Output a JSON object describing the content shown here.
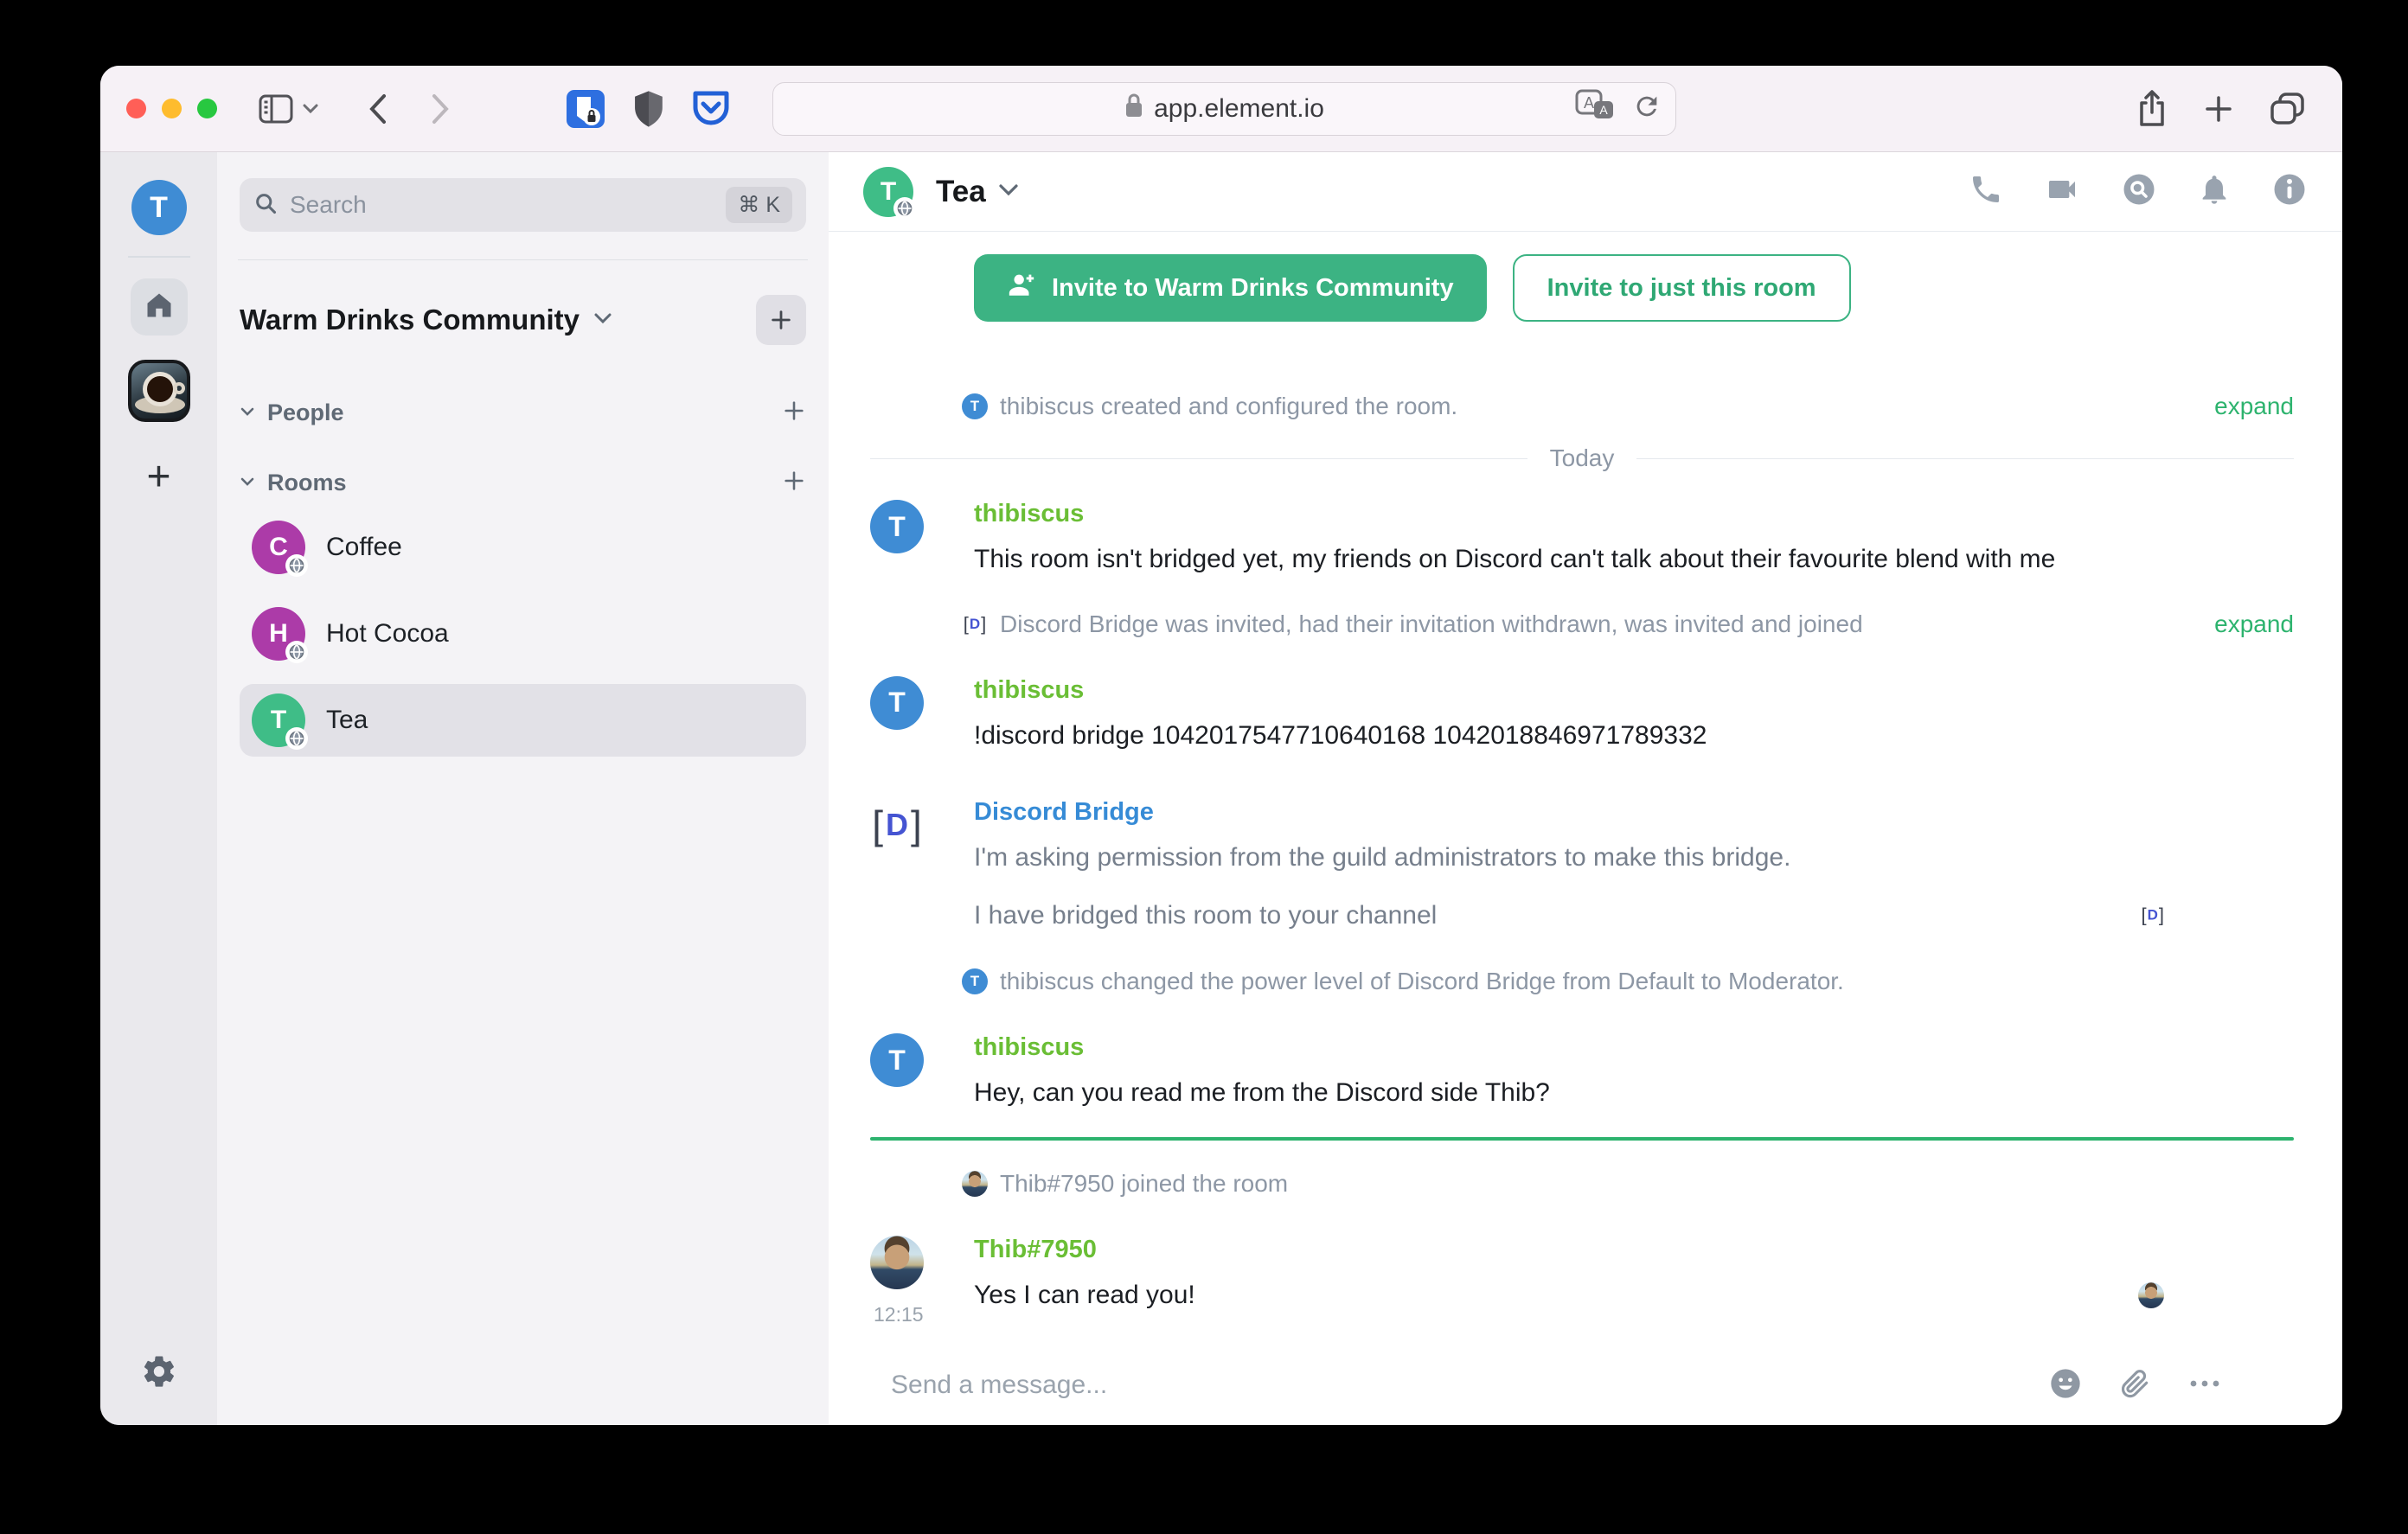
{
  "colors": {
    "accent_button_green": "#3cb383",
    "link_green": "#2db36e",
    "username_lime": "#6abe35",
    "username_blue": "#368bd6",
    "avatar_blue": "#3f8cd4",
    "avatar_purple": "#ac3ba8",
    "avatar_green": "#3fbd87"
  },
  "browser": {
    "url": "app.element.io"
  },
  "rail": {
    "user_initial": "T"
  },
  "sidebar": {
    "search": {
      "placeholder": "Search",
      "shortcut": "⌘ K"
    },
    "community_name": "Warm Drinks Community",
    "people_label": "People",
    "rooms_label": "Rooms",
    "rooms": [
      {
        "name": "Coffee",
        "initial": "C"
      },
      {
        "name": "Hot Cocoa",
        "initial": "H"
      },
      {
        "name": "Tea",
        "initial": "T"
      }
    ]
  },
  "room": {
    "name": "Tea",
    "avatar_initial": "T",
    "invite_primary": "Invite to Warm Drinks Community",
    "invite_secondary": "Invite to just this room",
    "composer_placeholder": "Send a message..."
  },
  "timeline": {
    "created_event": {
      "avatar_initial": "T",
      "text": "thibiscus created and configured the room.",
      "action": "expand"
    },
    "day_separator": "Today",
    "msg_bridge_intro": {
      "sender": "thibiscus",
      "avatar_initial": "T",
      "text": "This room isn't bridged yet, my friends on Discord can't talk about their favourite blend with me"
    },
    "bridge_membership_event": {
      "text": "Discord Bridge was invited, had their invitation withdrawn, was invited and joined",
      "action": "expand"
    },
    "msg_bridge_command": {
      "sender": "thibiscus",
      "avatar_initial": "T",
      "text": "!discord bridge 1042017547710640168 1042018846971789332"
    },
    "msg_bridge_bot": {
      "sender": "Discord Bridge",
      "avatar_letter": "D",
      "bracket_left": "[",
      "bracket_right": "]",
      "line1": "I'm asking permission from the guild administrators to make this bridge.",
      "line2": "I have bridged this room to your channel"
    },
    "power_event": {
      "avatar_initial": "T",
      "text": "thibiscus changed the power level of Discord Bridge from Default to Moderator."
    },
    "msg_question": {
      "sender": "thibiscus",
      "avatar_initial": "T",
      "text": "Hey, can you read me from the Discord side Thib?"
    },
    "join_event": {
      "text": "Thib#7950 joined the room"
    },
    "msg_answer": {
      "sender": "Thib#7950",
      "time": "12:15",
      "text": "Yes I can read you!"
    }
  }
}
